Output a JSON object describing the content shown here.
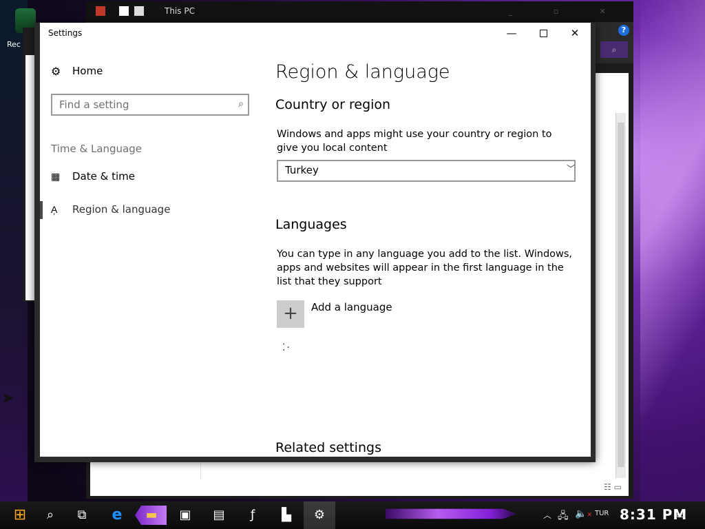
{
  "desktop": {
    "icon_label": "Rec"
  },
  "explorer": {
    "title": "This PC",
    "help": "?",
    "search_icon": "search-icon"
  },
  "settings": {
    "window_title": "Settings",
    "controls": {
      "minimize": "—",
      "close": "✕"
    },
    "nav": {
      "home": "Home",
      "search_placeholder": "Find a setting",
      "section": "Time & Language",
      "items": [
        {
          "label": "Date & time",
          "icon": "calendar-clock-icon"
        },
        {
          "label": "Region & language",
          "icon": "language-icon"
        }
      ]
    },
    "content": {
      "title": "Region & language",
      "country": {
        "heading": "Country or region",
        "description": "Windows and apps might use your country or region to give you local content",
        "selected": "Turkey"
      },
      "languages": {
        "heading": "Languages",
        "description": "You can type in any language you add to the list. Windows, apps and websites will appear in the first language in the list that they support",
        "add_label": "Add a language"
      },
      "related_heading": "Related settings"
    }
  },
  "taskbar": {
    "language": "TUR",
    "time": "8:31 PM"
  },
  "colors": {
    "accent": "#8a2be2",
    "window_bg": "#ffffff",
    "taskbar_bg": "#111111"
  }
}
